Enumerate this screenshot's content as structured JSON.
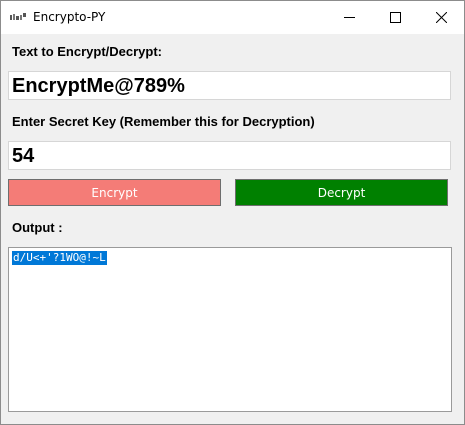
{
  "window": {
    "title": "Encrypto-PY",
    "icon": "app-icon"
  },
  "title_buttons": [
    "minimize-icon",
    "maximize-icon",
    "close-icon"
  ],
  "text_field": {
    "label": "Text to Encrypt/Decrypt:",
    "value": "EncryptMe@789%"
  },
  "key_field": {
    "label": "Enter Secret Key (Remember this for Decryption)",
    "value": "54"
  },
  "buttons": {
    "encrypt": "Encrypt",
    "decrypt": "Decrypt"
  },
  "output": {
    "label": "Output :",
    "value": "d/U<+'?1WO@!~L"
  },
  "colors": {
    "encrypt_button": "#f47c77",
    "decrypt_button": "#008000",
    "selection": "#0078d7"
  }
}
